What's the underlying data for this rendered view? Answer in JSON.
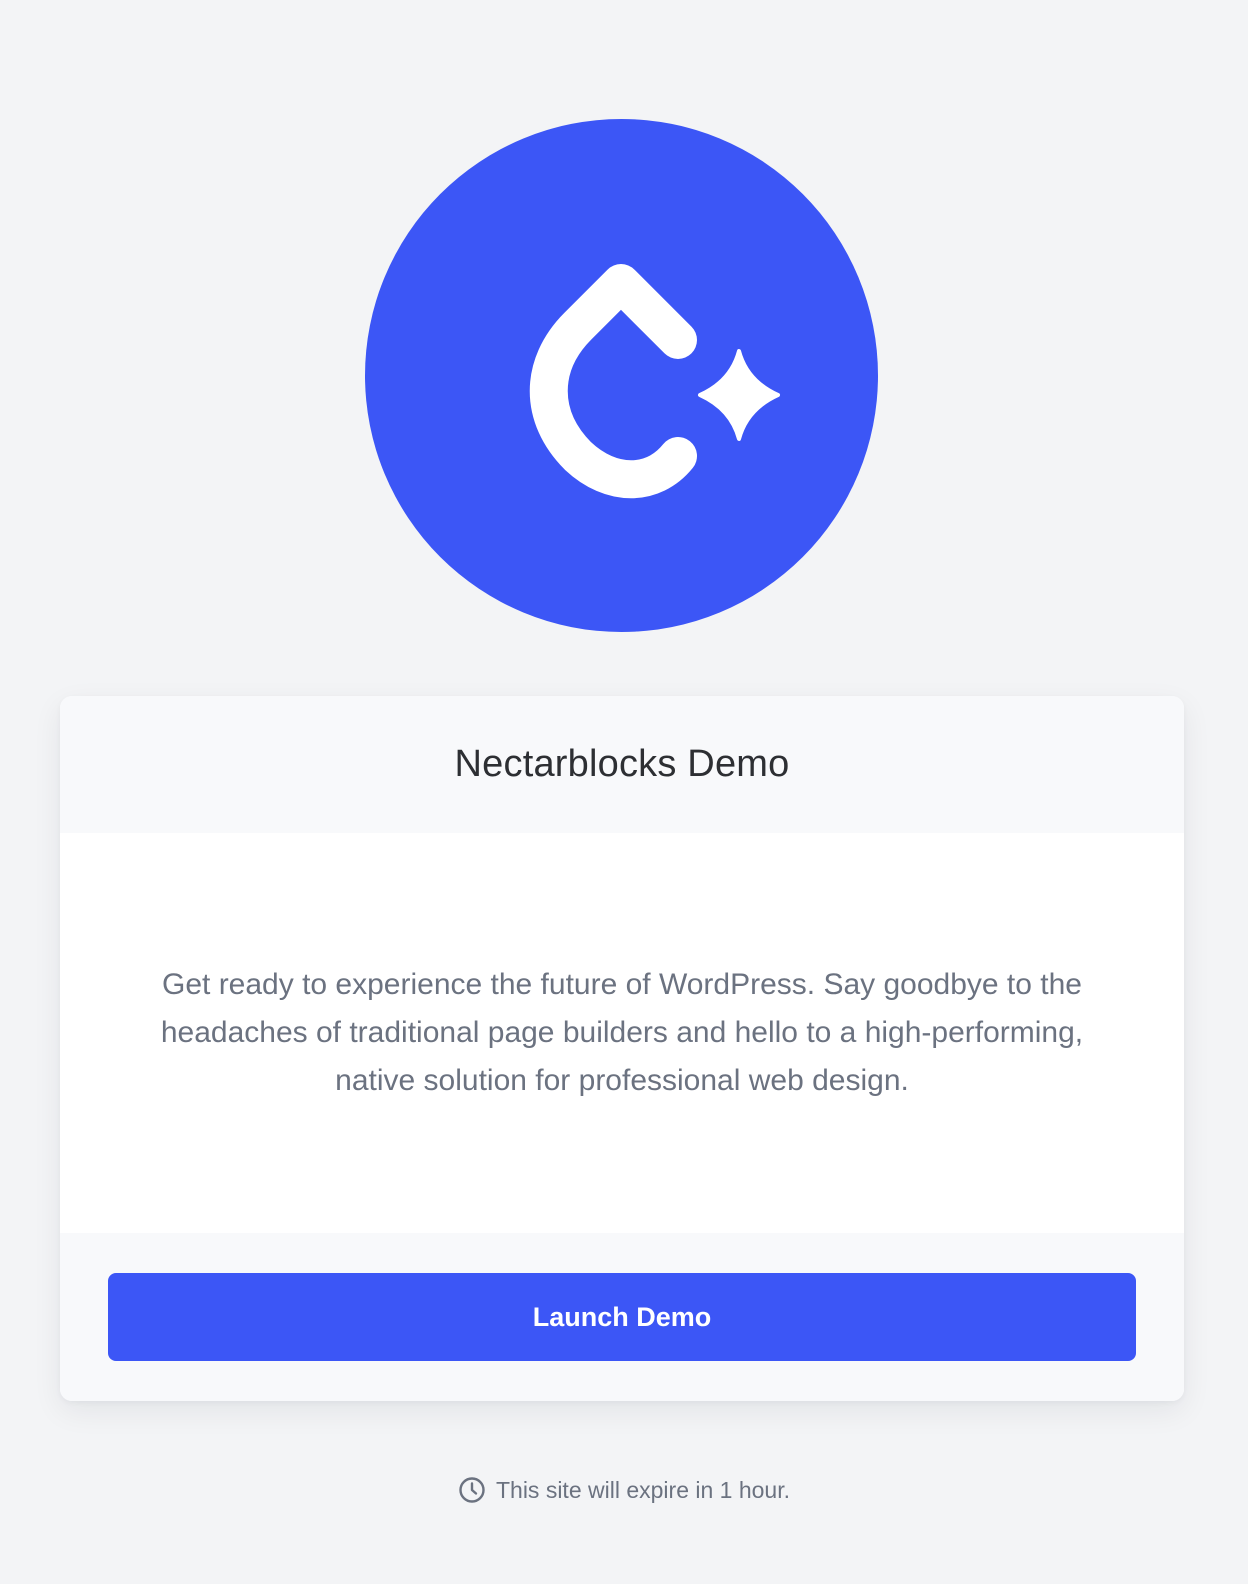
{
  "logo": {
    "icon": "nectarblocks-logo-icon",
    "background_color": "#3c56f6",
    "mark_color": "#ffffff"
  },
  "card": {
    "title": "Nectarblocks Demo",
    "description": "Get ready to experience the future of WordPress. Say goodbye to the headaches of traditional page builders and hello to a high-performing, native solution for professional web design.",
    "button_label": "Launch Demo",
    "button_color": "#3c56f6"
  },
  "footer": {
    "icon": "clock-icon",
    "expiry_text": "This site will expire in 1 hour."
  }
}
